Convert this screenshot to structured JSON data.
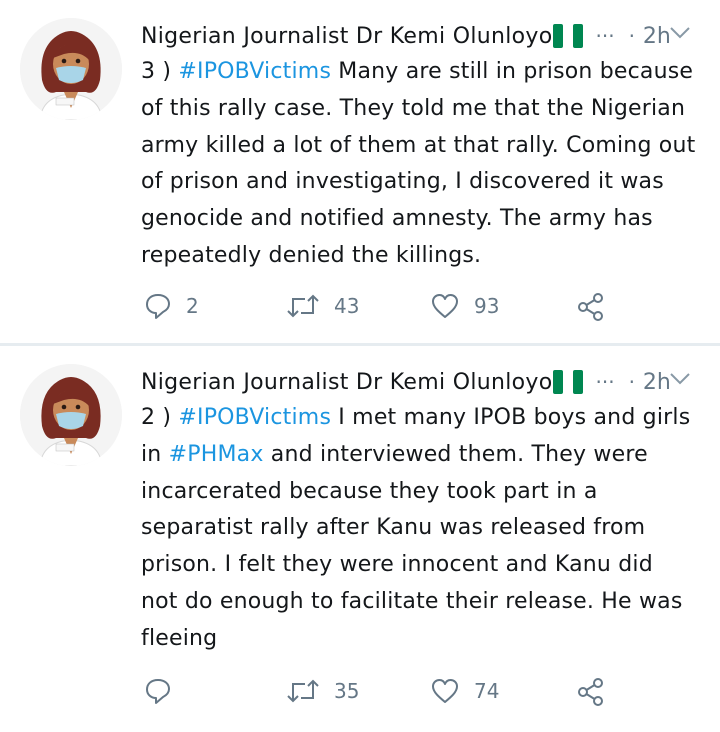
{
  "tweets": [
    {
      "author": "Nigerian Journalist Dr Kemi Olunloyo",
      "more": "···",
      "separator": "·",
      "time": "2h",
      "lines": [
        [
          {
            "text": "3 ) ",
            "tag": false
          },
          {
            "text": "#IPOBVictims",
            "tag": true
          },
          {
            "text": " Many are still in prison because",
            "tag": false
          }
        ],
        [
          {
            "text": "of this rally case. They told me that the Nigerian",
            "tag": false
          }
        ],
        [
          {
            "text": "army killed a lot of them at that rally. Coming out",
            "tag": false
          }
        ],
        [
          {
            "text": "of prison and investigating, I discovered it was",
            "tag": false
          }
        ],
        [
          {
            "text": "genocide and notified amnesty. The army has",
            "tag": false
          }
        ],
        [
          {
            "text": "repeatedly denied the killings.",
            "tag": false
          }
        ]
      ],
      "replies": "2",
      "retweets": "43",
      "likes": "93"
    },
    {
      "author": "Nigerian Journalist Dr Kemi Olunloyo",
      "more": "···",
      "separator": "·",
      "time": "2h",
      "lines": [
        [
          {
            "text": "2 ) ",
            "tag": false
          },
          {
            "text": "#IPOBVictims",
            "tag": true
          },
          {
            "text": " I met many IPOB boys and girls",
            "tag": false
          }
        ],
        [
          {
            "text": "in ",
            "tag": false
          },
          {
            "text": "#PHMax",
            "tag": true
          },
          {
            "text": " and interviewed them. They were",
            "tag": false
          }
        ],
        [
          {
            "text": "incarcerated because they took part in a",
            "tag": false
          }
        ],
        [
          {
            "text": "separatist rally after Kanu was released from",
            "tag": false
          }
        ],
        [
          {
            "text": "prison. I felt they were innocent and Kanu did",
            "tag": false
          }
        ],
        [
          {
            "text": "not do enough to facilitate their release. He was",
            "tag": false
          }
        ],
        [
          {
            "text": "fleeing",
            "tag": false
          }
        ]
      ],
      "replies": "",
      "retweets": "35",
      "likes": "74"
    }
  ],
  "colors": {
    "hashtag": "#1b95e0",
    "meta": "#657786",
    "divider": "#e6ecf0",
    "flag_green": "#008751"
  },
  "icons": {
    "flag": "nigeria-flag-icon",
    "reply": "reply-icon",
    "retweet": "retweet-icon",
    "like": "heart-icon",
    "share": "share-icon",
    "chevron": "chevron-down-icon"
  }
}
